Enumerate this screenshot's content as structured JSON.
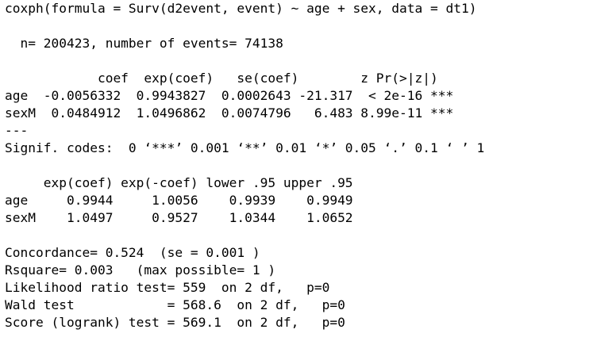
{
  "console": {
    "call": "coxph(formula = Surv(d2event, event) ~ age + sex, data = dt1)",
    "summary_counts": "  n= 200423, number of events= 74138",
    "coef_table": {
      "header": "            coef  exp(coef)   se(coef)        z Pr(>|z|)",
      "rows": [
        "age  -0.0056332  0.9943827  0.0002643 -21.317  < 2e-16 ***",
        "sexM  0.0484912  1.0496862  0.0074796   6.483 8.99e-11 ***"
      ]
    },
    "separator": "---",
    "signif_codes": "Signif. codes:  0 ‘***’ 0.001 ‘**’ 0.01 ‘*’ 0.05 ‘.’ 0.1 ‘ ’ 1",
    "ci_table": {
      "header": "     exp(coef) exp(-coef) lower .95 upper .95",
      "rows": [
        "age     0.9944     1.0056    0.9939    0.9949",
        "sexM    1.0497     0.9527    1.0344    1.0652"
      ]
    },
    "fit_stats": [
      "Concordance= 0.524  (se = 0.001 )",
      "Rsquare= 0.003   (max possible= 1 )",
      "Likelihood ratio test= 559  on 2 df,   p=0",
      "Wald test            = 568.6  on 2 df,   p=0",
      "Score (logrank) test = 569.1  on 2 df,   p=0"
    ]
  }
}
